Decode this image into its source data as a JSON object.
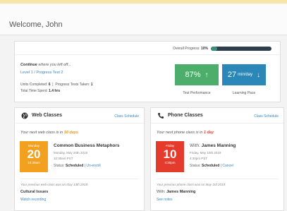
{
  "header": {
    "welcome": "Welcome, John"
  },
  "progress": {
    "overall_label": "Overall Progress:",
    "overall_value": "10%",
    "overall_fraction": 0.1,
    "continue_bold": "Continue",
    "continue_rest": " where you left off...",
    "level_link": "Level 1 / Progress Test 2",
    "units_label": "Units Completed:",
    "units_value": "6",
    "tests_label": "Progress Tests Taken:",
    "tests_value": "1",
    "time_label": "Total Time Spent:",
    "time_value": "1.4 hrs",
    "performance_value": "87%",
    "performance_label": "Test Performance",
    "pace_value": "27",
    "pace_unit": "min/day",
    "pace_label": "Learning Pace"
  },
  "web": {
    "title": "Web Classes",
    "schedule_link": "Class Schedule",
    "next_prefix": "Your next web class is in",
    "next_value": "10 days",
    "cal_weekday": "Monday",
    "cal_day": "20",
    "cal_time": "10:30am",
    "class_title": "Common Business Metaphors",
    "class_date": "Monday, May 20th 2019",
    "class_time": "10:30am PST",
    "status_label": "Status:",
    "status_value": "Scheduled",
    "status_link": "Un-enroll",
    "prev_line": "Your previous web class was on May 13th 2019:",
    "prev_title": "Cultural Issues",
    "prev_link": "Watch recording"
  },
  "phone": {
    "title": "Phone Classes",
    "schedule_link": "Class Schedule",
    "next_prefix": "Your next phone class is in",
    "next_value": "1 day",
    "cal_weekday": "Friday",
    "cal_day": "10",
    "cal_time": "4:30pm",
    "with_prefix": "With:",
    "with_name": "James Manning",
    "class_date": "Friday, May 10th 2019",
    "class_time": "4:30pm PST",
    "status_label": "Status:",
    "status_value": "Scheduled",
    "status_link": "Cancel",
    "prev_line": "Your previous phone class was on May 3rd 2019:",
    "prev_with_prefix": "With:",
    "prev_with_name": "James Manning",
    "prev_link": "See notes"
  },
  "colors": {
    "performance_tile": "#4dae6c",
    "pace_tile": "#2a87b8",
    "web_calendar": "#f2a01e",
    "phone_calendar": "#e53b2c",
    "link": "#3b86c4"
  },
  "icons": {
    "performance": "arrow-up-icon",
    "pace": "arrow-down-icon",
    "web": "globe-icon",
    "phone": "phone-icon"
  }
}
